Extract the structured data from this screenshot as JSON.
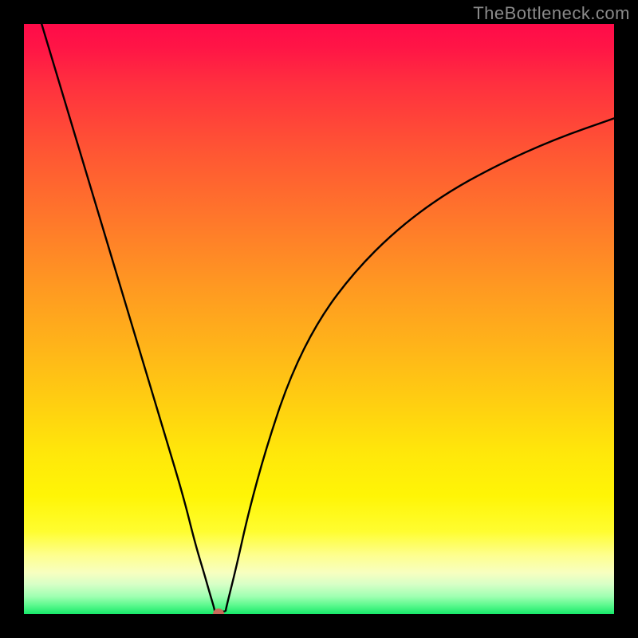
{
  "watermark": "TheBottleneck.com",
  "colors": {
    "frame": "#000000",
    "curve_stroke": "#000000",
    "marker": "#c96a5a",
    "watermark": "#8a8a8a"
  },
  "chart_data": {
    "type": "line",
    "title": "",
    "xlabel": "",
    "ylabel": "",
    "xlim": [
      0,
      100
    ],
    "ylim": [
      0,
      100
    ],
    "gradient_direction": "vertical_top_red_bottom_green",
    "marker": {
      "x": 33,
      "y": 0
    },
    "series": [
      {
        "name": "left-branch",
        "x": [
          3,
          6,
          9,
          12,
          15,
          18,
          21,
          24,
          27,
          29,
          30.5,
          31.5,
          32.3
        ],
        "y": [
          100,
          90,
          80,
          70,
          60,
          50,
          40,
          30,
          20,
          12,
          7,
          3.5,
          0.8
        ]
      },
      {
        "name": "valley-flat",
        "x": [
          32.3,
          34.2
        ],
        "y": [
          0.4,
          0.4
        ]
      },
      {
        "name": "right-branch",
        "x": [
          34.2,
          36,
          38,
          41,
          45,
          50,
          56,
          63,
          71,
          80,
          90,
          100
        ],
        "y": [
          0.8,
          8,
          17,
          28,
          40,
          50,
          58,
          65,
          71,
          76,
          80.5,
          84
        ]
      }
    ]
  }
}
